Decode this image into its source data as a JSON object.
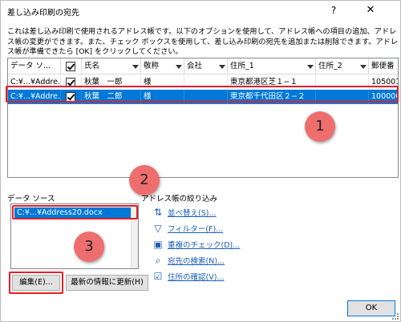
{
  "window": {
    "title": "差し込み印刷の宛先",
    "help_label": "?",
    "close_label": "✕"
  },
  "description": "これは差し込み印刷で使用されるアドレス帳です。以下のオプションを使用して、アドレス帳への項目の追加、アドレス帳の変更ができます。また、チェック ボックスを使用して、差し込み印刷の宛先を追加または削除できます。アドレス帳が準備できたら [OK] をクリックしてください。",
  "table": {
    "columns": [
      "データ ソ...",
      "",
      "氏名",
      "敬称",
      "会社",
      "住所_1",
      "住所_2",
      "郵便番"
    ],
    "rows": [
      {
        "source": "C:¥...¥Addre...",
        "checked": true,
        "name": "秋葉　一郎",
        "honorific": "様",
        "company": "",
        "address1": "東京都港区芝１−１",
        "address2": "",
        "postal": "105001"
      },
      {
        "source": "C:¥...¥Addre...",
        "checked": true,
        "name": "秋葉　二郎",
        "honorific": "様",
        "company": "",
        "address1": "東京都千代田区２−２",
        "address2": "",
        "postal": "100000"
      }
    ]
  },
  "data_source": {
    "label": "データ ソース",
    "items": [
      "C:¥...¥Address20.docx"
    ],
    "edit_button": "編集(E)...",
    "refresh_button": "最新の情報に更新(H)"
  },
  "refine": {
    "label": "アドレス帳の絞り込み",
    "links": [
      {
        "label": "並べ替え(S)...",
        "icon": "sort-icon"
      },
      {
        "label": "フィルター(F)...",
        "icon": "filter-icon"
      },
      {
        "label": "重複のチェック(D)...",
        "icon": "duplicate-icon"
      },
      {
        "label": "宛先の検索(N)...",
        "icon": "search-icon"
      },
      {
        "label": "住所の確認(V)...",
        "icon": "address-validate-icon"
      }
    ]
  },
  "ok_button": "OK",
  "callouts": [
    "1",
    "2",
    "3"
  ],
  "colors": {
    "selection": "#0078d7",
    "highlight_box": "#e81e25",
    "callout": "#ee6e6e",
    "link": "#1a5db5"
  }
}
